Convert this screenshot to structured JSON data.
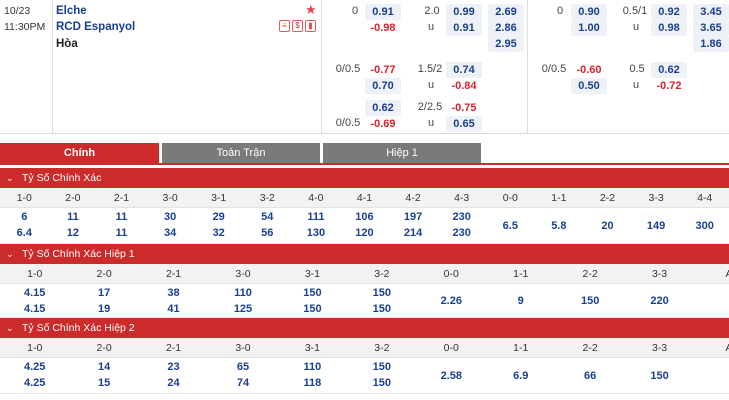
{
  "match": {
    "date": "10/23",
    "time": "11:30PM",
    "home": "Elche",
    "away": "RCD Espanyol",
    "draw": "Hòa",
    "icons": [
      "star-icon",
      "stats-icon",
      "money-icon",
      "chart-icon"
    ]
  },
  "odds": {
    "ft_hdp": {
      "line": "0",
      "home": "0.91",
      "away": "-0.98"
    },
    "ft_ou": {
      "line": "2.0",
      "over": "0.99",
      "u": "u",
      "under": "0.91"
    },
    "ft_1x2": {
      "home": "2.69",
      "away": "2.86",
      "draw": "2.95"
    },
    "ft_hdp2": {
      "line": "0/0.5",
      "home": "-0.77",
      "away": "0.70"
    },
    "ft_ou2": {
      "line": "1.5/2",
      "over": "0.74",
      "u": "u",
      "under": "-0.84"
    },
    "ft_hdp3": {
      "line": "0/0.5",
      "home": "0.62",
      "away": "-0.69"
    },
    "ft_ou3": {
      "line": "2/2.5",
      "over": "-0.75",
      "u": "u",
      "under": "0.65"
    },
    "h1_hdp": {
      "line": "0",
      "home": "0.90",
      "away": "1.00"
    },
    "h1_ou": {
      "line": "0.5/1",
      "over": "0.92",
      "u": "u",
      "under": "0.98"
    },
    "h1_1x2": {
      "home": "3.45",
      "away": "3.65",
      "draw": "1.86"
    },
    "h1_hdp2": {
      "line": "0/0.5",
      "home": "-0.60",
      "away": "0.50"
    },
    "h1_ou2": {
      "line": "0.5",
      "over": "0.62",
      "u": "u",
      "under": "-0.72"
    }
  },
  "tabs": [
    "Chính",
    "Toàn Trận",
    "Hiệp 1"
  ],
  "sections": [
    {
      "title": "Tỷ Số Chính Xác",
      "cols": [
        "1-0",
        "2-0",
        "2-1",
        "3-0",
        "3-1",
        "3-2",
        "4-0",
        "4-1",
        "4-2",
        "4-3",
        "0-0",
        "1-1",
        "2-2",
        "3-3",
        "4-4"
      ],
      "row1": [
        "6",
        "11",
        "11",
        "30",
        "29",
        "54",
        "111",
        "106",
        "197",
        "230",
        "6.5",
        "5.8",
        "20",
        "149",
        "300"
      ],
      "row2": [
        "6.4",
        "12",
        "11",
        "34",
        "32",
        "56",
        "130",
        "120",
        "214",
        "230",
        "",
        "",
        "",
        "",
        ""
      ]
    },
    {
      "title": "Tỷ Số Chính Xác Hiệp 1",
      "cols": [
        "1-0",
        "2-0",
        "2-1",
        "3-0",
        "3-1",
        "3-2",
        "0-0",
        "1-1",
        "2-2",
        "3-3",
        "A"
      ],
      "row1": [
        "4.15",
        "17",
        "38",
        "110",
        "150",
        "150",
        "2.26",
        "9",
        "150",
        "220",
        ""
      ],
      "row2": [
        "4.15",
        "19",
        "41",
        "125",
        "150",
        "150",
        "",
        "",
        "",
        "",
        ""
      ]
    },
    {
      "title": "Tỷ Số Chính Xác Hiệp 2",
      "cols": [
        "1-0",
        "2-0",
        "2-1",
        "3-0",
        "3-1",
        "3-2",
        "0-0",
        "1-1",
        "2-2",
        "3-3",
        "A"
      ],
      "row1": [
        "4.25",
        "14",
        "23",
        "65",
        "110",
        "150",
        "2.58",
        "6.9",
        "66",
        "150",
        ""
      ],
      "row2": [
        "4.25",
        "15",
        "24",
        "74",
        "118",
        "150",
        "",
        "",
        "",
        "",
        ""
      ]
    }
  ]
}
